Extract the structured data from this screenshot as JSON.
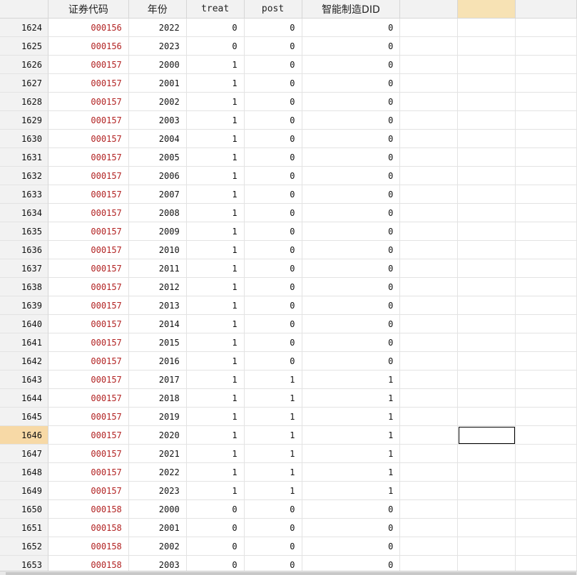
{
  "columns": [
    "",
    "证券代码",
    "年份",
    "treat",
    "post",
    "智能制造DID",
    "",
    "",
    ""
  ],
  "selected_row": "1646",
  "rows": [
    {
      "n": "1624",
      "code": "000156",
      "year": "2022",
      "treat": "0",
      "post": "0",
      "did": "0"
    },
    {
      "n": "1625",
      "code": "000156",
      "year": "2023",
      "treat": "0",
      "post": "0",
      "did": "0"
    },
    {
      "n": "1626",
      "code": "000157",
      "year": "2000",
      "treat": "1",
      "post": "0",
      "did": "0"
    },
    {
      "n": "1627",
      "code": "000157",
      "year": "2001",
      "treat": "1",
      "post": "0",
      "did": "0"
    },
    {
      "n": "1628",
      "code": "000157",
      "year": "2002",
      "treat": "1",
      "post": "0",
      "did": "0"
    },
    {
      "n": "1629",
      "code": "000157",
      "year": "2003",
      "treat": "1",
      "post": "0",
      "did": "0"
    },
    {
      "n": "1630",
      "code": "000157",
      "year": "2004",
      "treat": "1",
      "post": "0",
      "did": "0"
    },
    {
      "n": "1631",
      "code": "000157",
      "year": "2005",
      "treat": "1",
      "post": "0",
      "did": "0"
    },
    {
      "n": "1632",
      "code": "000157",
      "year": "2006",
      "treat": "1",
      "post": "0",
      "did": "0"
    },
    {
      "n": "1633",
      "code": "000157",
      "year": "2007",
      "treat": "1",
      "post": "0",
      "did": "0"
    },
    {
      "n": "1634",
      "code": "000157",
      "year": "2008",
      "treat": "1",
      "post": "0",
      "did": "0"
    },
    {
      "n": "1635",
      "code": "000157",
      "year": "2009",
      "treat": "1",
      "post": "0",
      "did": "0"
    },
    {
      "n": "1636",
      "code": "000157",
      "year": "2010",
      "treat": "1",
      "post": "0",
      "did": "0"
    },
    {
      "n": "1637",
      "code": "000157",
      "year": "2011",
      "treat": "1",
      "post": "0",
      "did": "0"
    },
    {
      "n": "1638",
      "code": "000157",
      "year": "2012",
      "treat": "1",
      "post": "0",
      "did": "0"
    },
    {
      "n": "1639",
      "code": "000157",
      "year": "2013",
      "treat": "1",
      "post": "0",
      "did": "0"
    },
    {
      "n": "1640",
      "code": "000157",
      "year": "2014",
      "treat": "1",
      "post": "0",
      "did": "0"
    },
    {
      "n": "1641",
      "code": "000157",
      "year": "2015",
      "treat": "1",
      "post": "0",
      "did": "0"
    },
    {
      "n": "1642",
      "code": "000157",
      "year": "2016",
      "treat": "1",
      "post": "0",
      "did": "0"
    },
    {
      "n": "1643",
      "code": "000157",
      "year": "2017",
      "treat": "1",
      "post": "1",
      "did": "1"
    },
    {
      "n": "1644",
      "code": "000157",
      "year": "2018",
      "treat": "1",
      "post": "1",
      "did": "1"
    },
    {
      "n": "1645",
      "code": "000157",
      "year": "2019",
      "treat": "1",
      "post": "1",
      "did": "1"
    },
    {
      "n": "1646",
      "code": "000157",
      "year": "2020",
      "treat": "1",
      "post": "1",
      "did": "1"
    },
    {
      "n": "1647",
      "code": "000157",
      "year": "2021",
      "treat": "1",
      "post": "1",
      "did": "1"
    },
    {
      "n": "1648",
      "code": "000157",
      "year": "2022",
      "treat": "1",
      "post": "1",
      "did": "1"
    },
    {
      "n": "1649",
      "code": "000157",
      "year": "2023",
      "treat": "1",
      "post": "1",
      "did": "1"
    },
    {
      "n": "1650",
      "code": "000158",
      "year": "2000",
      "treat": "0",
      "post": "0",
      "did": "0"
    },
    {
      "n": "1651",
      "code": "000158",
      "year": "2001",
      "treat": "0",
      "post": "0",
      "did": "0"
    },
    {
      "n": "1652",
      "code": "000158",
      "year": "2002",
      "treat": "0",
      "post": "0",
      "did": "0"
    },
    {
      "n": "1653",
      "code": "000158",
      "year": "2003",
      "treat": "0",
      "post": "0",
      "did": "0"
    }
  ]
}
